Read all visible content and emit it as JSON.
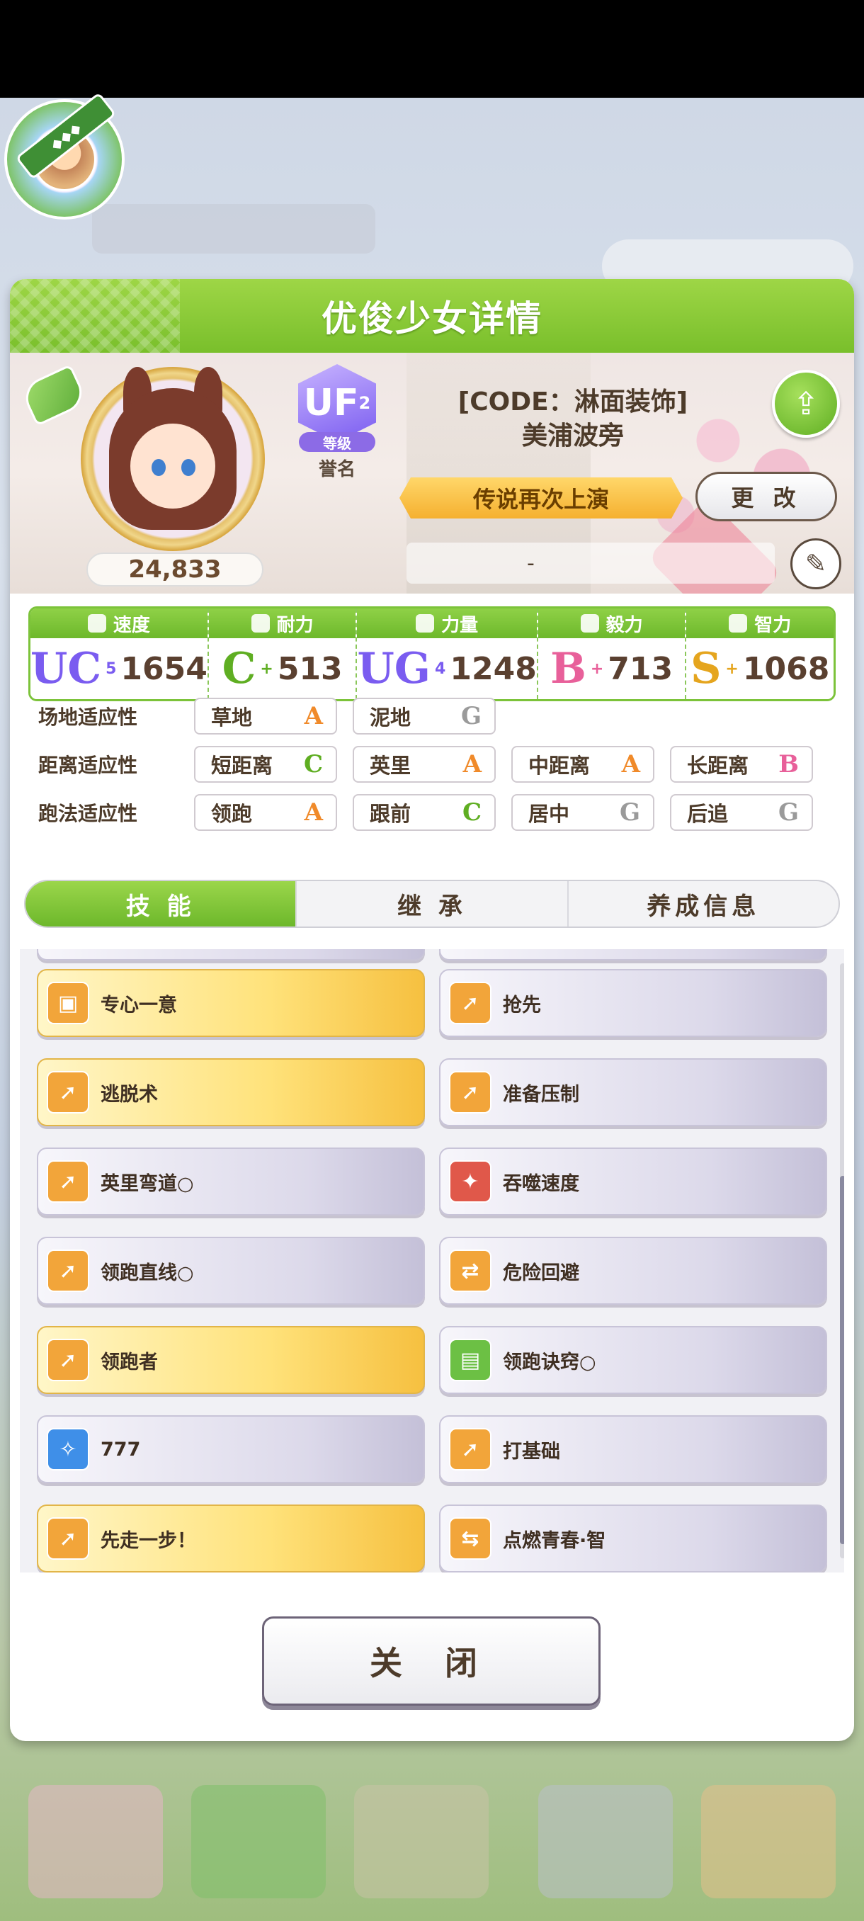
{
  "dialog": {
    "title": "优俊少女详情",
    "fans": "24,833",
    "rank": {
      "badge_text": "UF",
      "sub": "2",
      "tag": "等级",
      "label": "誉名"
    },
    "code": "[CODE：淋面装饰]",
    "name": "美浦波旁",
    "epithet": "传说再次上演",
    "change_label": "更 改",
    "comment": "-",
    "close_label": "关 闭"
  },
  "stats": [
    {
      "label": "速度",
      "grade": "UC",
      "grade_sup": "5",
      "value": "1654",
      "color": "#7a5cf0"
    },
    {
      "label": "耐力",
      "grade": "C",
      "grade_sup": "+",
      "value": "513",
      "color": "#5fae22"
    },
    {
      "label": "力量",
      "grade": "UG",
      "grade_sup": "4",
      "value": "1248",
      "color": "#7a5cf0"
    },
    {
      "label": "毅力",
      "grade": "B",
      "grade_sup": "+",
      "value": "713",
      "color": "#e8609a"
    },
    {
      "label": "智力",
      "grade": "S",
      "grade_sup": "+",
      "value": "1068",
      "color": "#e5a51e"
    }
  ],
  "aptitude": {
    "track_label": "场地适应性",
    "track": [
      {
        "name": "草地",
        "grade": "A"
      },
      {
        "name": "泥地",
        "grade": "G"
      }
    ],
    "distance_label": "距离适应性",
    "distance": [
      {
        "name": "短距离",
        "grade": "C"
      },
      {
        "name": "英里",
        "grade": "A"
      },
      {
        "name": "中距离",
        "grade": "A"
      },
      {
        "name": "长距离",
        "grade": "B"
      }
    ],
    "style_label": "跑法适应性",
    "style": [
      {
        "name": "领跑",
        "grade": "A"
      },
      {
        "name": "跟前",
        "grade": "C"
      },
      {
        "name": "居中",
        "grade": "G"
      },
      {
        "name": "后追",
        "grade": "G"
      }
    ]
  },
  "grade_colors": {
    "A": "#f08a2a",
    "B": "#e8609a",
    "C": "#5fae22",
    "G": "#9a9a9a"
  },
  "tabs": [
    {
      "label": "技 能"
    },
    {
      "label": "继 承"
    },
    {
      "label": "养成信息"
    }
  ],
  "skills": [
    {
      "name": "专心一意",
      "type": "gold",
      "icon": "focus-icon"
    },
    {
      "name": "抢先",
      "type": "normal",
      "icon": "runner-icon"
    },
    {
      "name": "逃脱术",
      "type": "gold",
      "icon": "runner-icon"
    },
    {
      "name": "准备压制",
      "type": "normal",
      "icon": "runner-icon"
    },
    {
      "name": "英里弯道○",
      "type": "normal",
      "icon": "runner-icon"
    },
    {
      "name": "吞噬速度",
      "type": "normal",
      "icon": "debuff-icon"
    },
    {
      "name": "领跑直线○",
      "type": "normal",
      "icon": "runner-icon"
    },
    {
      "name": "危险回避",
      "type": "normal",
      "icon": "dodge-icon"
    },
    {
      "name": "领跑者",
      "type": "gold",
      "icon": "runner-icon"
    },
    {
      "name": "领跑诀窍○",
      "type": "normal",
      "icon": "book-icon"
    },
    {
      "name": "777",
      "type": "normal",
      "icon": "sparkle-icon"
    },
    {
      "name": "打基础",
      "type": "normal",
      "icon": "runner-icon"
    },
    {
      "name": "先走一步！",
      "type": "gold",
      "icon": "runner-icon"
    },
    {
      "name": "点燃青春·智",
      "type": "normal",
      "icon": "recover-icon"
    }
  ],
  "icon_colors": {
    "focus-icon": "#f2a53a",
    "runner-icon": "#f2a53a",
    "debuff-icon": "#e0584a",
    "dodge-icon": "#f2a53a",
    "book-icon": "#6cc044",
    "sparkle-icon": "#3f8fe8",
    "recover-icon": "#f2a53a"
  }
}
